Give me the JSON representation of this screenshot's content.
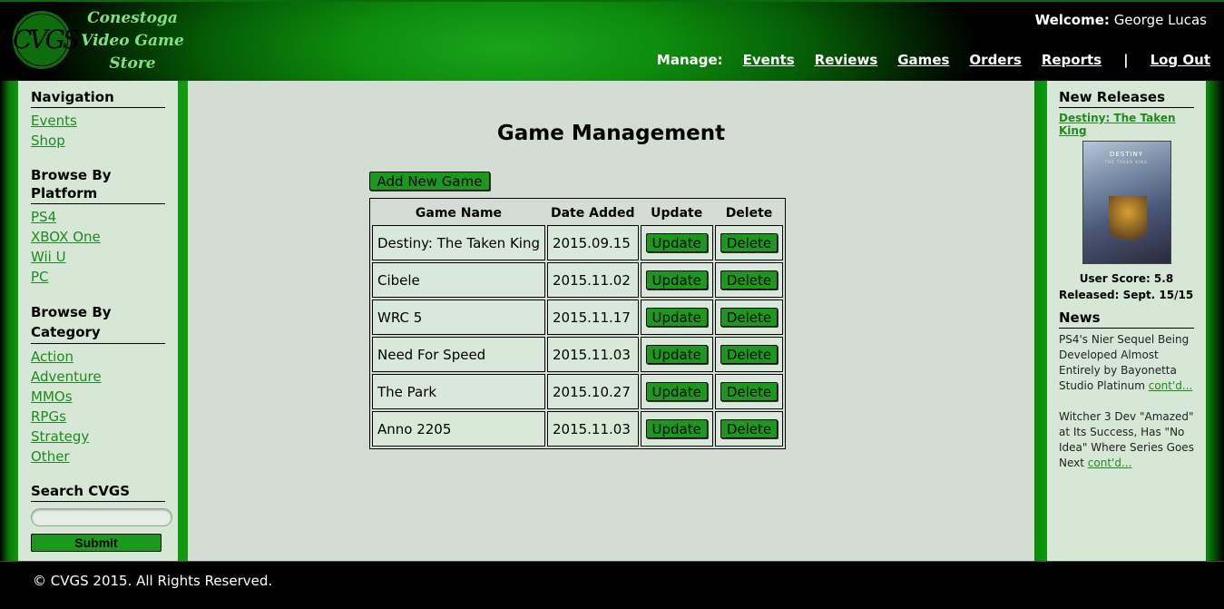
{
  "header": {
    "logo_text": "CVGS",
    "brand_lines": [
      "Conestoga",
      "Video Game",
      "Store"
    ],
    "welcome_label": "Welcome:",
    "welcome_user": "George Lucas",
    "manage_label": "Manage:",
    "nav": [
      "Events",
      "Reviews",
      "Games",
      "Orders",
      "Reports"
    ],
    "separator": "|",
    "logout": "Log Out"
  },
  "left": {
    "navigation": {
      "heading": "Navigation",
      "items": [
        "Events",
        "Shop"
      ]
    },
    "platform": {
      "heading": "Browse By Platform",
      "items": [
        "PS4",
        "XBOX One",
        "Wii U",
        "PC"
      ]
    },
    "category": {
      "heading": "Browse By Category",
      "items": [
        "Action",
        "Adventure",
        "MMOs",
        "RPGs",
        "Strategy",
        "Other"
      ]
    },
    "search": {
      "heading": "Search CVGS",
      "placeholder": "",
      "submit": "Submit"
    }
  },
  "main": {
    "title": "Game Management",
    "add_button": "Add New Game",
    "columns": [
      "Game Name",
      "Date Added",
      "Update",
      "Delete"
    ],
    "update_label": "Update",
    "delete_label": "Delete",
    "rows": [
      {
        "name": "Destiny: The Taken King",
        "date": "2015.09.15"
      },
      {
        "name": "Cibele",
        "date": "2015.11.02"
      },
      {
        "name": "WRC 5",
        "date": "2015.11.17"
      },
      {
        "name": "Need For Speed",
        "date": "2015.11.03"
      },
      {
        "name": "The Park",
        "date": "2015.10.27"
      },
      {
        "name": "Anno 2205",
        "date": "2015.11.03"
      }
    ]
  },
  "right": {
    "new_releases_heading": "New Releases",
    "featured_title": "Destiny: The Taken King",
    "cover_text": "DESTINY",
    "cover_sub": "THE TAKEN KING",
    "user_score": "User Score: 5.8",
    "released": "Released: Sept. 15/15",
    "news_heading": "News",
    "news": [
      {
        "text": "PS4's Nier Sequel Being Developed Almost Entirely by Bayonetta Studio Platinum ",
        "link": "cont'd..."
      },
      {
        "text": "Witcher 3 Dev \"Amazed\" at Its Success, Has \"No Idea\" Where Series Goes Next ",
        "link": "cont'd..."
      }
    ]
  },
  "footer": {
    "copyright": "© CVGS 2015. All Rights Reserved."
  },
  "colors": {
    "accent": "#1a9a1a",
    "link": "#1f8a1f",
    "panel": "#d6e7d6"
  }
}
